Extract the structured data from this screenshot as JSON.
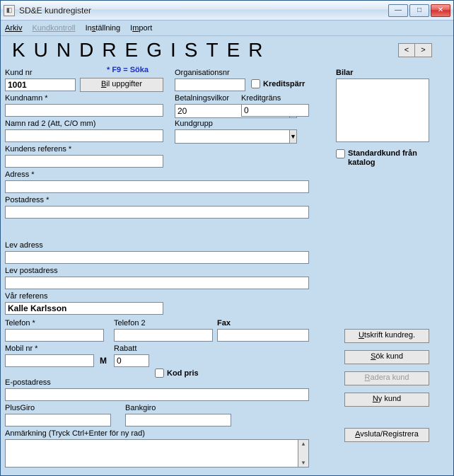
{
  "window": {
    "title": "SD&E kundregister"
  },
  "menu": {
    "arkiv": "Arkiv",
    "kundkontroll": "Kundkontroll",
    "installning": "Inställning",
    "import": "Import"
  },
  "page": {
    "title": "KUNDREGISTER",
    "hint": "* F9 = Söka",
    "nav_prev": "<",
    "nav_next": ">"
  },
  "labels": {
    "kund_nr": "Kund nr",
    "kundnamn": "Kundnamn *",
    "namn_rad2": "Namn rad 2 (Att, C/O mm)",
    "kund_ref": "Kundens referens *",
    "adress": "Adress *",
    "postadress": "Postadress *",
    "orgnr": "Organisationsnr",
    "betvillkor": "Betalningsvilkor",
    "kreditgrans": "Kreditgräns",
    "kundgrupp": "Kundgrupp",
    "bilar": "Bilar",
    "standardkund": "Standardkund från katalog",
    "kreditspärr": "Kreditspärr",
    "lev_adress": "Lev adress",
    "lev_postadress": "Lev postadress",
    "var_referens": "Vår referens",
    "telefon": "Telefon *",
    "telefon2": "Telefon 2",
    "fax": "Fax",
    "mobil": "Mobil nr *",
    "rabatt": "Rabatt",
    "kod_pris": "Kod pris",
    "epost": "E-postadress",
    "plusgiro": "PlusGiro",
    "bankgiro": "Bankgiro",
    "anmarkning": "Anmärkning (Tryck Ctrl+Enter för ny rad)",
    "m": "M"
  },
  "values": {
    "kund_nr": "1001",
    "kundnamn": "",
    "namn_rad2": "",
    "kund_ref": "",
    "adress": "",
    "postadress": "",
    "orgnr": "",
    "betvillkor": "20",
    "kreditgrans": "0",
    "kundgrupp": "",
    "lev_adress": "",
    "lev_postadress": "",
    "var_referens": "Kalle Karlsson",
    "telefon": "",
    "telefon2": "",
    "fax": "",
    "mobil": "",
    "rabatt": "0",
    "epost": "",
    "plusgiro": "",
    "bankgiro": "",
    "anmarkning": ""
  },
  "buttons": {
    "bil_uppgifter": "Bil uppgifter",
    "utskrift": "Utskrift kundreg.",
    "sok": "Sök kund",
    "radera": "Radera kund",
    "ny": "Ny kund",
    "avsluta": "Avsluta/Registrera"
  }
}
